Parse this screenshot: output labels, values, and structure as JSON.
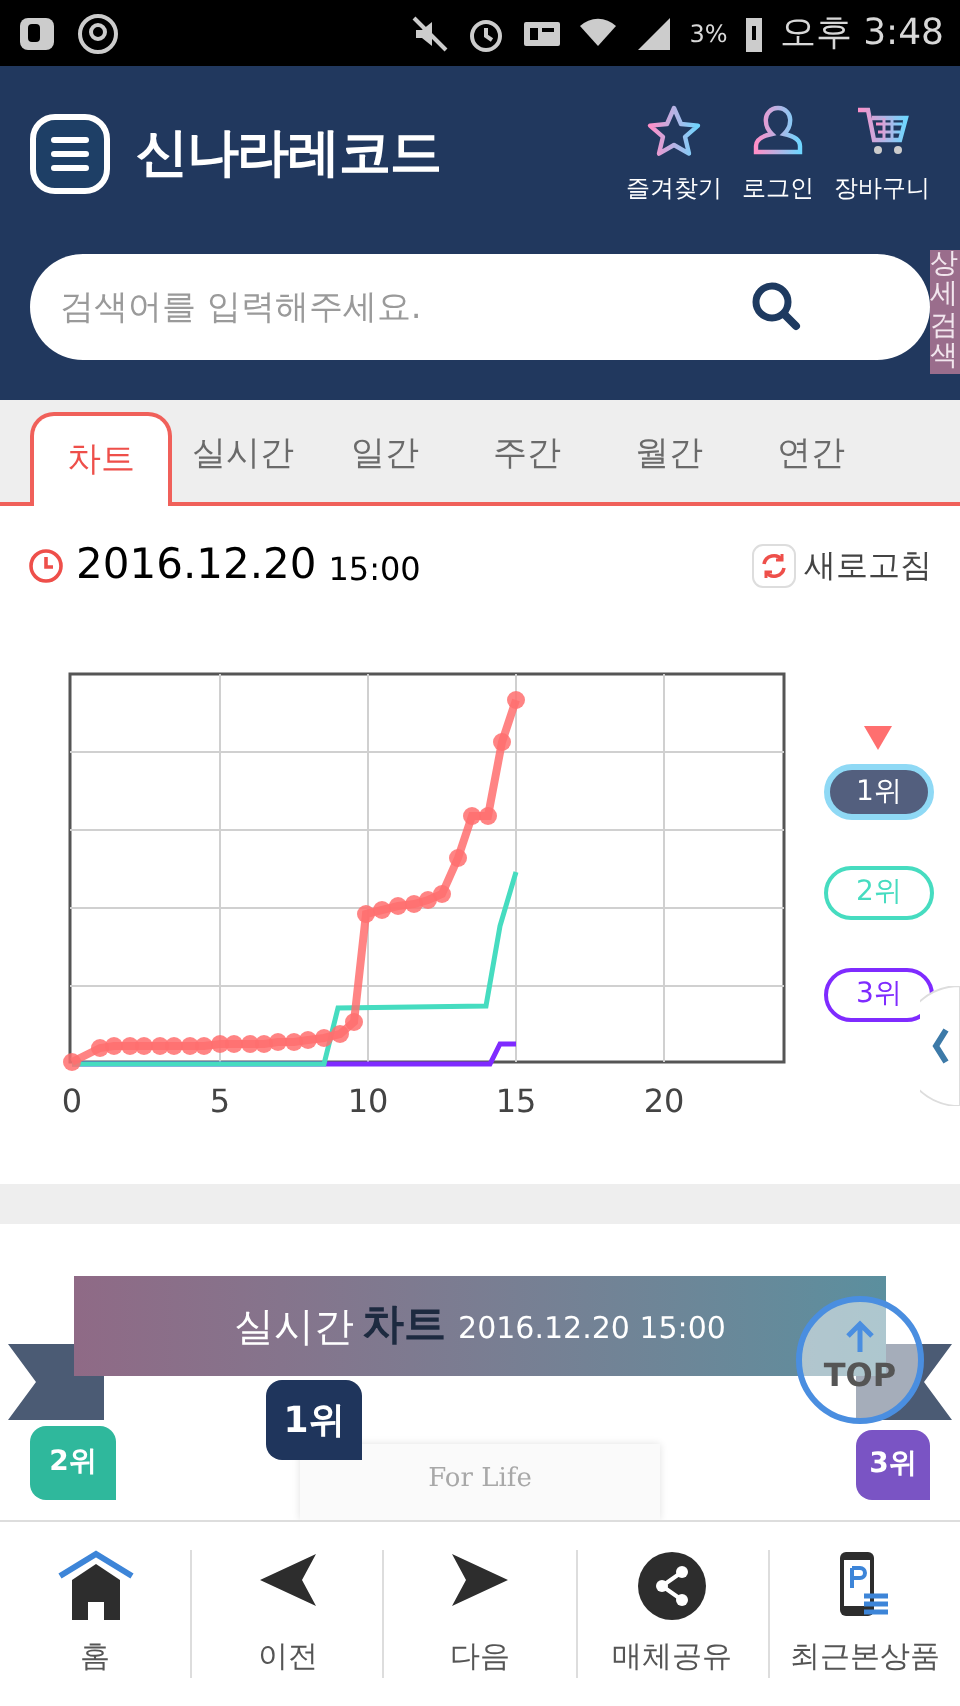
{
  "status_bar": {
    "battery": "3%",
    "time": "오후 3:48"
  },
  "header": {
    "logo": "신나라레코드",
    "actions": [
      {
        "label": "즐겨찾기"
      },
      {
        "label": "로그인"
      },
      {
        "label": "장바구니"
      }
    ],
    "search": {
      "placeholder": "검색어를 입력해주세요."
    },
    "detail_search": "상세검색"
  },
  "tabs": [
    {
      "label": "차트",
      "selected": true
    },
    {
      "label": "실시간",
      "selected": false
    },
    {
      "label": "일간",
      "selected": false
    },
    {
      "label": "주간",
      "selected": false
    },
    {
      "label": "월간",
      "selected": false
    },
    {
      "label": "연간",
      "selected": false
    }
  ],
  "date": {
    "day": "2016.12.20",
    "time": "15:00"
  },
  "refresh": "새로고침",
  "chart": {
    "x_labels": [
      "0",
      "5",
      "10",
      "15",
      "20"
    ],
    "legend": [
      {
        "label": "1위",
        "color": "#ff6f6f",
        "selected": true
      },
      {
        "label": "2위",
        "color": "#46dcc0",
        "selected": false
      },
      {
        "label": "3위",
        "color": "#7f2bff",
        "selected": false
      }
    ]
  },
  "ribbon": {
    "title": "실시간",
    "highlight": "차트",
    "date": "2016.12.20 15:00"
  },
  "ranks": [
    {
      "label": "2위",
      "color": "#2fb89c"
    },
    {
      "label": "1위",
      "color": "#1f355c"
    },
    {
      "label": "3위",
      "color": "#7a54c4"
    }
  ],
  "album": {
    "text": "For Life"
  },
  "top_button": "TOP",
  "nav": [
    {
      "label": "홈"
    },
    {
      "label": "이전"
    },
    {
      "label": "다음"
    },
    {
      "label": "매체공유"
    },
    {
      "label": "최근본상품"
    }
  ]
}
